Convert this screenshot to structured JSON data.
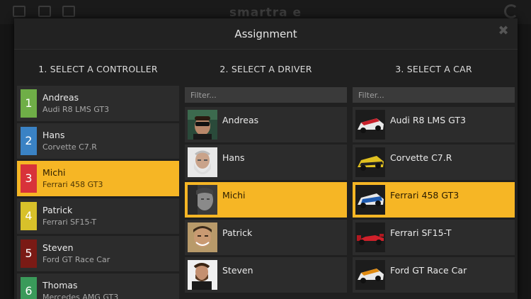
{
  "background": {
    "logo_text": "smartra  e"
  },
  "dialog": {
    "title": "Assignment",
    "close_symbol": "✖"
  },
  "columns": {
    "controller_title": "1. SELECT A CONTROLLER",
    "driver_title": "2. SELECT A DRIVER",
    "car_title": "3. SELECT A CAR"
  },
  "filters": {
    "driver_placeholder": "Filter...",
    "car_placeholder": "Filter..."
  },
  "controllers": [
    {
      "number": "1",
      "name": "Andreas",
      "car": "Audi R8 LMS GT3",
      "color": "#6fae47",
      "selected": false
    },
    {
      "number": "2",
      "name": "Hans",
      "car": "Corvette C7.R",
      "color": "#3a82c4",
      "selected": false
    },
    {
      "number": "3",
      "name": "Michi",
      "car": "Ferrari 458 GT3",
      "color": "#d8323a",
      "selected": true
    },
    {
      "number": "4",
      "name": "Patrick",
      "car": "Ferrari SF15-T",
      "color": "#d8c12a",
      "selected": false
    },
    {
      "number": "5",
      "name": "Steven",
      "car": "Ford GT Race Car",
      "color": "#7a1a15",
      "selected": false
    },
    {
      "number": "6",
      "name": "Thomas",
      "car": "Mercedes AMG GT3",
      "color": "#3a9a5a",
      "selected": false
    }
  ],
  "drivers": [
    {
      "name": "Andreas",
      "avatar": "driver-photo-andreas",
      "selected": false
    },
    {
      "name": "Hans",
      "avatar": "driver-photo-hans",
      "selected": false
    },
    {
      "name": "Michi",
      "avatar": "driver-photo-michi",
      "selected": true
    },
    {
      "name": "Patrick",
      "avatar": "driver-photo-patrick",
      "selected": false
    },
    {
      "name": "Steven",
      "avatar": "driver-photo-steven",
      "selected": false
    }
  ],
  "cars": [
    {
      "name": "Audi R8 LMS GT3",
      "image": "car-audi-r8",
      "selected": false
    },
    {
      "name": "Corvette C7.R",
      "image": "car-corvette",
      "selected": false
    },
    {
      "name": "Ferrari 458 GT3",
      "image": "car-ferrari-458",
      "selected": true
    },
    {
      "name": "Ferrari SF15-T",
      "image": "car-ferrari-sf15",
      "selected": false
    },
    {
      "name": "Ford GT Race Car",
      "image": "car-ford-gt",
      "selected": false
    }
  ],
  "colors": {
    "accent": "#f6b625",
    "panel": "#202020",
    "row": "#2c2c2c"
  }
}
